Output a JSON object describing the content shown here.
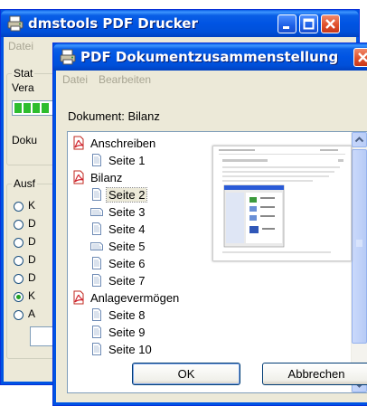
{
  "back_window": {
    "title": "dmstools PDF Drucker",
    "menu": [
      "Datei"
    ],
    "status_group_label": "Stat",
    "status_row_text": "Vera",
    "doc_text": "Doku",
    "output_group_label": "Ausf",
    "radio_letters": [
      "K",
      "D",
      "D",
      "D",
      "D",
      "K",
      "A"
    ],
    "checked_radio_index": 5
  },
  "front_window": {
    "title": "PDF Dokumentzusammenstellung",
    "menu": [
      "Datei",
      "Bearbeiten"
    ],
    "document_label": "Dokument: Bilanz",
    "tree": [
      {
        "label": "Anschreiben",
        "level": 0,
        "type": "pdf"
      },
      {
        "label": "Seite 1",
        "level": 1,
        "type": "page"
      },
      {
        "label": "Bilanz",
        "level": 0,
        "type": "pdf"
      },
      {
        "label": "Seite 2",
        "level": 1,
        "type": "page",
        "selected": true
      },
      {
        "label": "Seite 3",
        "level": 1,
        "type": "page-landscape"
      },
      {
        "label": "Seite 4",
        "level": 1,
        "type": "page"
      },
      {
        "label": "Seite 5",
        "level": 1,
        "type": "page-landscape"
      },
      {
        "label": "Seite 6",
        "level": 1,
        "type": "page"
      },
      {
        "label": "Seite 7",
        "level": 1,
        "type": "page"
      },
      {
        "label": "Anlagevermögen",
        "level": 0,
        "type": "pdf"
      },
      {
        "label": "Seite 8",
        "level": 1,
        "type": "page"
      },
      {
        "label": "Seite 9",
        "level": 1,
        "type": "page"
      },
      {
        "label": "Seite 10",
        "level": 1,
        "type": "page"
      }
    ],
    "ok_label": "OK",
    "cancel_label": "Abbrechen"
  },
  "colors": {
    "titlebar": "#0054e3",
    "window_face": "#ece9d8",
    "pdf_red": "#d1242f",
    "progress_green": "#2dbd2d"
  },
  "icons": {
    "app": "printer-icon",
    "pdf": "pdf-file-icon",
    "page": "page-icon",
    "page_landscape": "landscape-page-icon"
  }
}
